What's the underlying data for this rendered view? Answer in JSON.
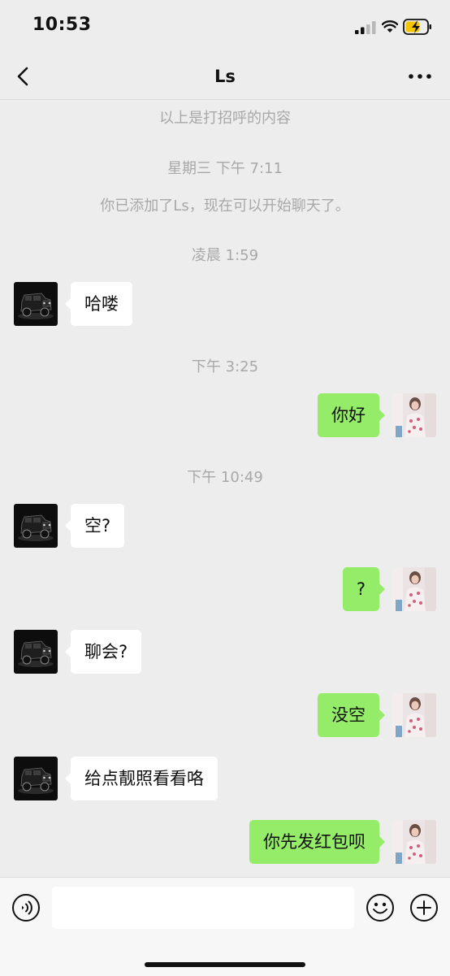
{
  "status_bar": {
    "time": "10:53"
  },
  "header": {
    "title": "Ls"
  },
  "chat": {
    "system": {
      "greeting_note": "以上是打招呼的内容",
      "time_wed": "星期三 下午 7:11",
      "added_notice": "你已添加了Ls，现在可以开始聊天了。",
      "time_early": "凌晨 1:59",
      "time_pm1": "下午 3:25",
      "time_pm2": "下午 10:49"
    },
    "messages": [
      {
        "side": "in",
        "text": "哈喽"
      },
      {
        "side": "out",
        "text": "你好"
      },
      {
        "side": "in",
        "text": "空?"
      },
      {
        "side": "out",
        "text": "?"
      },
      {
        "side": "in",
        "text": "聊会?"
      },
      {
        "side": "out",
        "text": "没空"
      },
      {
        "side": "in",
        "text": "给点靓照看看咯"
      },
      {
        "side": "out",
        "text": "你先发红包呗"
      }
    ]
  },
  "icons": {
    "back": "chevron-left-icon",
    "more": "more-dots-icon",
    "voice": "voice-icon",
    "emoji": "emoji-icon",
    "plus": "plus-icon"
  },
  "colors": {
    "background": "#ededed",
    "outgoing_bubble": "#95ec69",
    "incoming_bubble": "#ffffff",
    "system_text": "#a8a8a8",
    "battery_fill": "#f5c500"
  }
}
